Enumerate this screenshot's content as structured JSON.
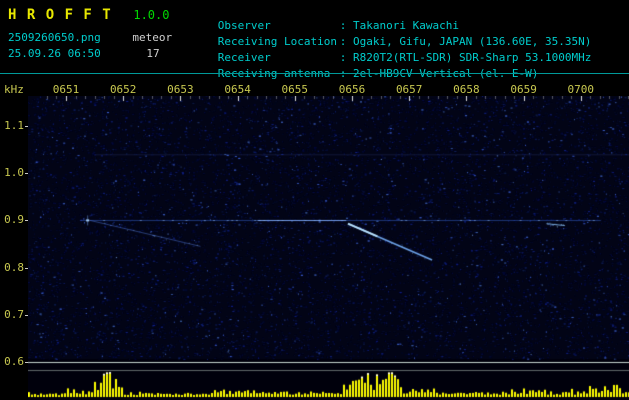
{
  "header": {
    "app_name": "H R O F F T",
    "version": "1.0.0",
    "filename": "2509260650.png",
    "mode": "meteor",
    "datetime": "25.09.26 06:50",
    "count": "17",
    "fields": [
      {
        "label": "Observer",
        "value": ": Takanori Kawachi"
      },
      {
        "label": "Receiving Location",
        "value": ": Ogaki, Gifu, JAPAN (136.60E, 35.35N)"
      },
      {
        "label": "Receiver",
        "value": ": R820T2(RTL-SDR) SDR-Sharp 53.1000MHz"
      },
      {
        "label": "Receiving antenna",
        "value": ": 2el-HB9CV Vertical (el. E-W)"
      }
    ]
  },
  "colors": {
    "background": "#000000",
    "title_yellow": "#e8e800",
    "version_green": "#00d800",
    "info_cyan": "#00cccc",
    "axis_yellow": "#c8c850",
    "separator_teal": "#009a9a",
    "noise_blue": "#101860",
    "carrier_blue": "#3c6ee6",
    "echo_cyan": "#8cc8ff",
    "level_bar_yellow": "#ffff00"
  },
  "chart_data": {
    "type": "heatmap",
    "subtype": "radio-meteor-spectrogram",
    "title": "",
    "xlabel": "",
    "ylabel": "kHz",
    "x_tick_labels": [
      "0651",
      "0652",
      "0653",
      "0654",
      "0655",
      "0656",
      "0657",
      "0658",
      "0659",
      "0700"
    ],
    "y_tick_labels": [
      "1.1",
      "1.0",
      "0.9",
      "0.8",
      "0.7",
      "0.6"
    ],
    "y_tick_khz": [
      1.1,
      1.0,
      0.9,
      0.8,
      0.7,
      0.6
    ],
    "ylim_khz": [
      0.6,
      1.16
    ],
    "minutes_per_division": 1,
    "grid": false,
    "legend": false,
    "carrier_line": {
      "freq_khz": 0.9,
      "from_min": 0.25,
      "to_min": 9.35,
      "bright_from_min": 3.35,
      "bright_to_min": 4.9
    },
    "interference_line": {
      "freq_khz": 1.04,
      "from_min": 0.5,
      "to_min": 9.85
    },
    "meteor_echoes": [
      {
        "kind": "head-echo",
        "at_min": 0.37,
        "freq_khz": 0.9
      },
      {
        "kind": "drifting-trail",
        "from_min": 0.42,
        "freq_from_khz": 0.9,
        "to_min": 2.35,
        "freq_to_khz": 0.845,
        "strength": "faint"
      },
      {
        "kind": "drifting-trail",
        "from_min": 4.93,
        "freq_from_khz": 0.893,
        "to_min": 6.4,
        "freq_to_khz": 0.816,
        "strength": "strong"
      },
      {
        "kind": "short-echo",
        "from_min": 8.4,
        "freq_from_khz": 0.893,
        "to_min": 8.72,
        "freq_to_khz": 0.889,
        "strength": "medium"
      }
    ],
    "level_strip": {
      "color": "#ffff00",
      "clusters": [
        {
          "from_frac": 0.0,
          "to_frac": 0.06,
          "amp": 0.12
        },
        {
          "from_frac": 0.06,
          "to_frac": 0.105,
          "amp": 0.22
        },
        {
          "from_frac": 0.105,
          "to_frac": 0.155,
          "amp": 0.95
        },
        {
          "from_frac": 0.155,
          "to_frac": 0.3,
          "amp": 0.15
        },
        {
          "from_frac": 0.3,
          "to_frac": 0.38,
          "amp": 0.28
        },
        {
          "from_frac": 0.38,
          "to_frac": 0.52,
          "amp": 0.18
        },
        {
          "from_frac": 0.52,
          "to_frac": 0.615,
          "amp": 1.0
        },
        {
          "from_frac": 0.615,
          "to_frac": 0.68,
          "amp": 0.3
        },
        {
          "from_frac": 0.68,
          "to_frac": 0.8,
          "amp": 0.17
        },
        {
          "from_frac": 0.8,
          "to_frac": 0.86,
          "amp": 0.3
        },
        {
          "from_frac": 0.86,
          "to_frac": 0.93,
          "amp": 0.2
        },
        {
          "from_frac": 0.93,
          "to_frac": 0.985,
          "amp": 0.45
        },
        {
          "from_frac": 0.985,
          "to_frac": 1.0,
          "amp": 0.25
        }
      ]
    }
  }
}
